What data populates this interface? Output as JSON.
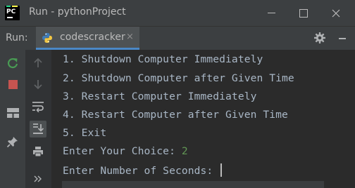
{
  "window": {
    "title": "Run - pythonProject",
    "logo_text": "PC"
  },
  "run_panel": {
    "label": "Run:",
    "tab_label": "codescracker",
    "tab_close": "×"
  },
  "console": {
    "lines": [
      "1. Shutdown Computer Immediately",
      "2. Shutdown Computer after Given Time",
      "3. Restart Computer Immediately",
      "4. Restart Computer after Given Time",
      "5. Exit"
    ],
    "choice_prompt": "Enter Your Choice: ",
    "choice_value": "2",
    "seconds_prompt": "Enter Number of Seconds: "
  },
  "colors": {
    "console_text": "#a9b7c6",
    "user_input": "#629755",
    "tab_accent": "#4a88c7",
    "stop_red": "#c75450",
    "rerun_green": "#499c54"
  },
  "icons": {
    "left_toolbar": [
      "rerun-icon",
      "stop-icon",
      "layout-icon",
      "pin-icon"
    ],
    "mid_toolbar": [
      "up-arrow-icon",
      "down-arrow-icon",
      "soft-wrap-icon",
      "scroll-to-end-icon",
      "print-icon",
      "more-icon"
    ],
    "header": [
      "python-icon",
      "gear-icon",
      "minimize-icon"
    ]
  }
}
